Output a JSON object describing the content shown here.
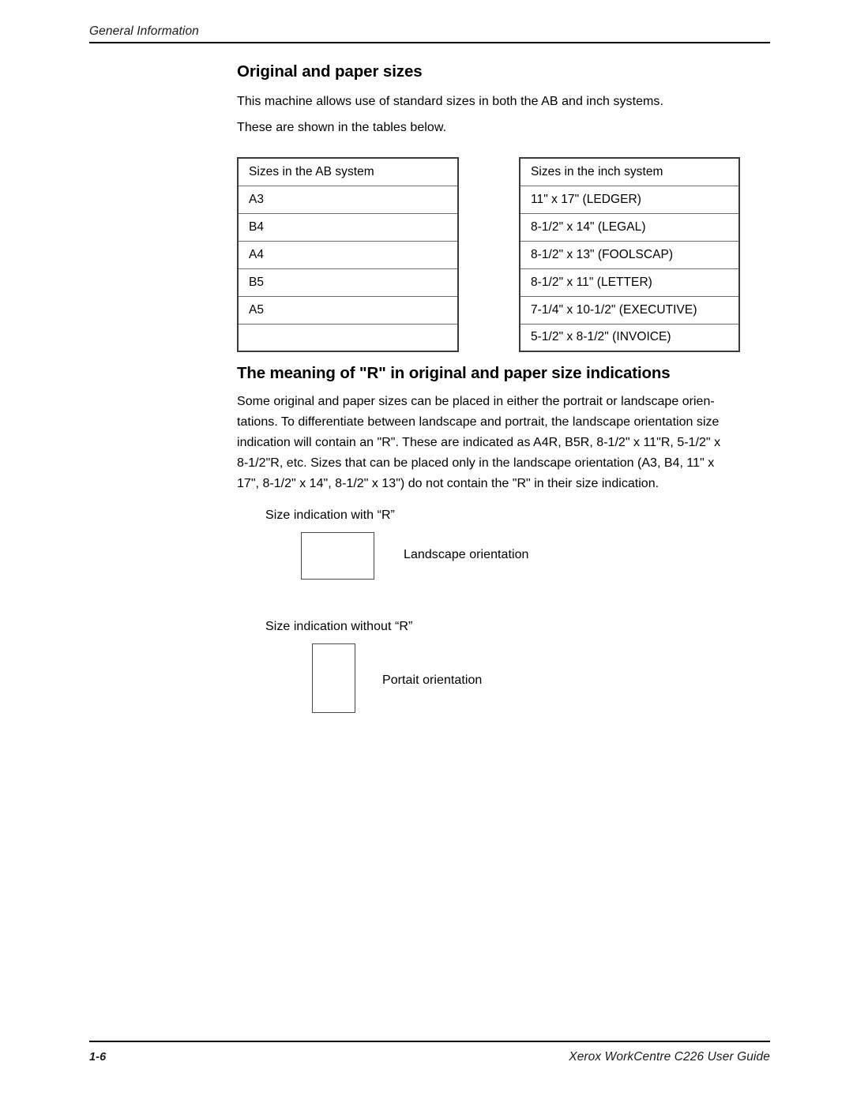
{
  "header": {
    "running_title": "General Information"
  },
  "section_sizes": {
    "heading": "Original and paper sizes",
    "paragraph_line_1": "This machine allows use of standard sizes in both the AB and inch systems.",
    "paragraph_line_2": "These are shown in the tables below.",
    "ab_table": {
      "header": "Sizes in the AB system",
      "rows": [
        "A3",
        "B4",
        "A4",
        "B5",
        "A5",
        ""
      ]
    },
    "inch_table": {
      "header": "Sizes in the inch system",
      "rows": [
        "11\" x 17\" (LEDGER)",
        "8-1/2\" x 14\" (LEGAL)",
        "8-1/2\" x 13\" (FOOLSCAP)",
        "8-1/2\" x 11\" (LETTER)",
        "7-1/4\" x 10-1/2\" (EXECUTIVE)",
        "5-1/2\" x 8-1/2\" (INVOICE)"
      ]
    }
  },
  "section_r_meaning": {
    "heading": "The meaning of \"R\" in original and paper size indications",
    "paragraph_lines": [
      "Some original and paper sizes can be placed in either the portrait or landscape orien-",
      "tations. To differentiate between landscape and portrait, the landscape orientation size",
      "indication will contain an \"R\". These are indicated as A4R, B5R, 8-1/2\" x 11\"R, 5-1/2\" x",
      "8-1/2\"R, etc. Sizes that can be placed only in the landscape orientation (A3, B4, 11\" x",
      "17\", 8-1/2\" x 14\", 8-1/2\" x 13\") do not contain the \"R\" in their size indication."
    ],
    "figures": [
      {
        "caption": "Size indication with “R”",
        "orientation_label": "Landscape orientation"
      },
      {
        "caption": "Size indication without “R”",
        "orientation_label": "Portait orientation"
      }
    ]
  },
  "footer": {
    "page_number": "1-6",
    "document_title": "Xerox WorkCentre C226 User Guide"
  }
}
